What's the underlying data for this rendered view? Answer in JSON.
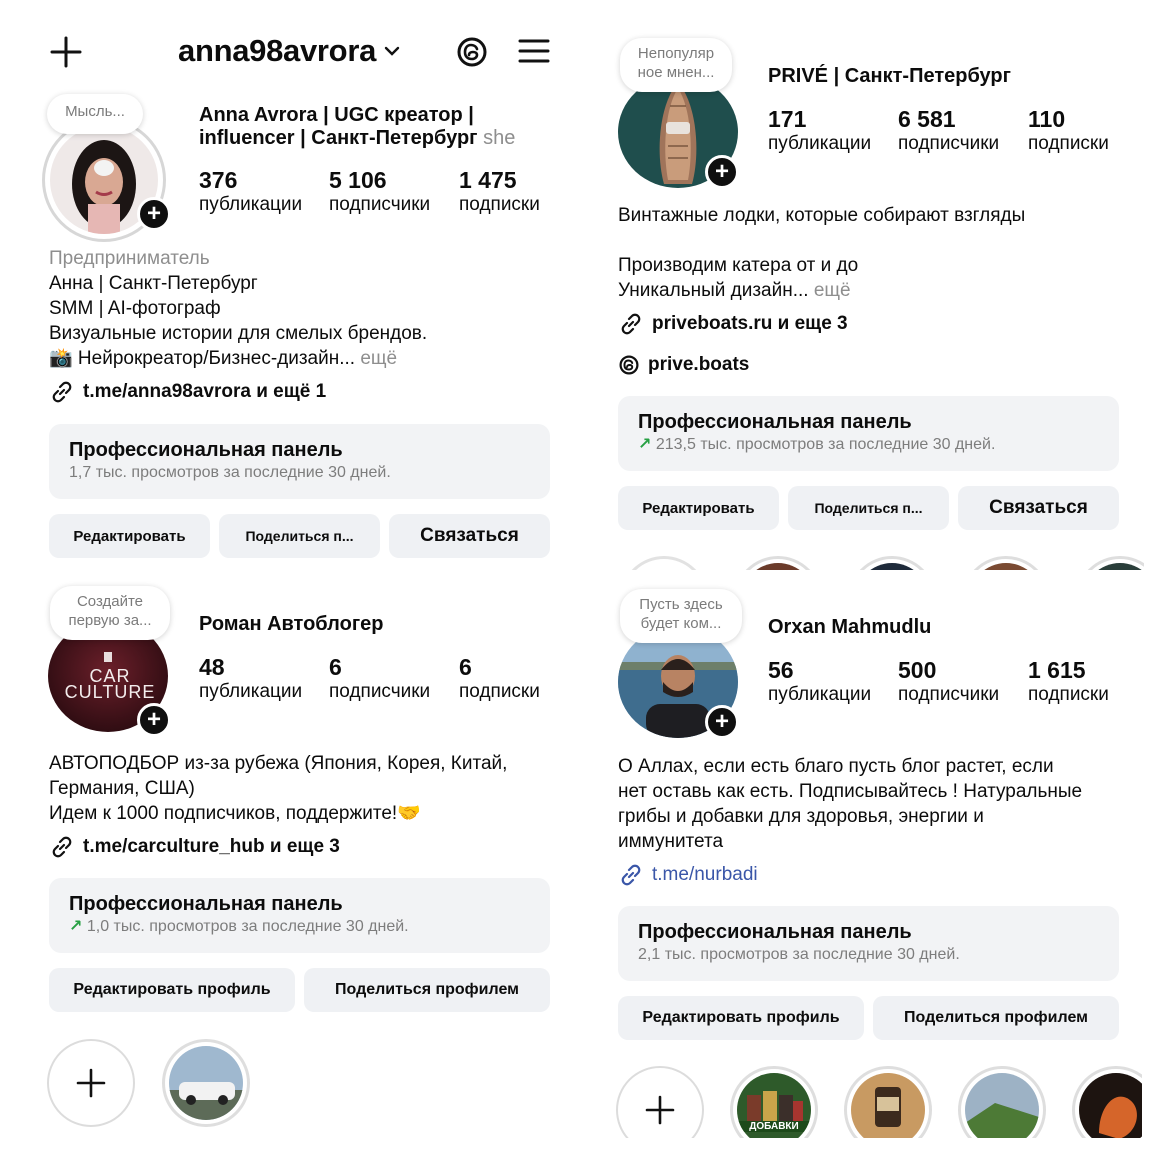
{
  "profile1": {
    "username": "anna98avrora",
    "note": "Мысль...",
    "name_line1": "Anna Avrora | UGC креатор |",
    "name_line2": "influencer | Санкт-Петербург",
    "pronoun": "she",
    "stats": [
      {
        "num": "376",
        "label": "публикации"
      },
      {
        "num": "5 106",
        "label": "подписчики"
      },
      {
        "num": "1 475",
        "label": "подписки"
      }
    ],
    "category": "Предприниматель",
    "bio": [
      "Анна | Санкт-Петербург",
      "SMM | AI-фотограф",
      "Визуальные истории для смелых брендов."
    ],
    "bio_last": "📸 Нейрокреатор/Бизнес-дизайн...",
    "more": "ещё",
    "link": "t.me/anna98avrora и ещё 1",
    "dashboard_title": "Профессиональная панель",
    "dashboard_sub": "1,7 тыс. просмотров за последние 30 дней.",
    "btn_edit": "Редактировать",
    "btn_share": "Поделиться п...",
    "btn_contact": "Связаться"
  },
  "profile2": {
    "note_line1": "Непопуляр",
    "note_line2": "ное мнен...",
    "name": "PRIVÉ | Санкт-Петербург",
    "stats": [
      {
        "num": "171",
        "label": "публикации"
      },
      {
        "num": "6 581",
        "label": "подписчики"
      },
      {
        "num": "110",
        "label": "подписки"
      }
    ],
    "bio_line1": "Винтажные лодки, которые собирают взгляды",
    "bio_line2": "Производим катера от и до",
    "bio_line3": "Уникальный дизайн...",
    "more": "ещё",
    "link": "priveboats.ru и еще 3",
    "threads": "prive.boats",
    "dashboard_title": "Профессиональная панель",
    "dashboard_sub": "213,5 тыс. просмотров за последние 30 дней.",
    "btn_edit": "Редактировать",
    "btn_share": "Поделиться п...",
    "btn_contact": "Связаться"
  },
  "profile3": {
    "note_line1": "Создайте",
    "note_line2": "первую за...",
    "avatar_text1": "CAR",
    "avatar_text2": "CULTURE",
    "name": "Роман Автоблогер",
    "stats": [
      {
        "num": "48",
        "label": "публикации"
      },
      {
        "num": "6",
        "label": "подписчики"
      },
      {
        "num": "6",
        "label": "подписки"
      }
    ],
    "bio_line1": "АВТОПОДБОР из-за рубежа (Япония, Корея, Китай,",
    "bio_line2": "Германия, США)",
    "bio_line3": "Идем к 1000 подписчиков, поддержите!🤝",
    "link": "t.me/carculture_hub и еще 3",
    "dashboard_title": "Профессиональная панель",
    "dashboard_sub": "1,0 тыс. просмотров за последние 30 дней.",
    "btn_edit": "Редактировать профиль",
    "btn_share": "Поделиться профилем"
  },
  "profile4": {
    "note_line1": "Пусть здесь",
    "note_line2": "будет ком...",
    "name": "Orxan Mahmudlu",
    "stats": [
      {
        "num": "56",
        "label": "публикации"
      },
      {
        "num": "500",
        "label": "подписчики"
      },
      {
        "num": "1 615",
        "label": "подписки"
      }
    ],
    "bio_line1": "О Аллах, если есть благо пусть блог растет, если",
    "bio_line2": "нет оставь как есть. Подписывайтесь ! Натуральные",
    "bio_line3": "грибы и добавки для здоровья, энергии и",
    "bio_line4": "иммунитета",
    "link": "t.me/nurbadi",
    "story_label": "ДОБАВКИ",
    "dashboard_title": "Профессиональная панель",
    "dashboard_sub": "2,1 тыс. просмотров за последние 30 дней.",
    "btn_edit": "Редактировать профиль",
    "btn_share": "Поделиться профилем"
  },
  "colors": {
    "button_bg": "#eff1f4",
    "dashboard_bg": "#f2f3f5",
    "trend_green": "#27a043",
    "link_blue": "#3a56a8"
  }
}
